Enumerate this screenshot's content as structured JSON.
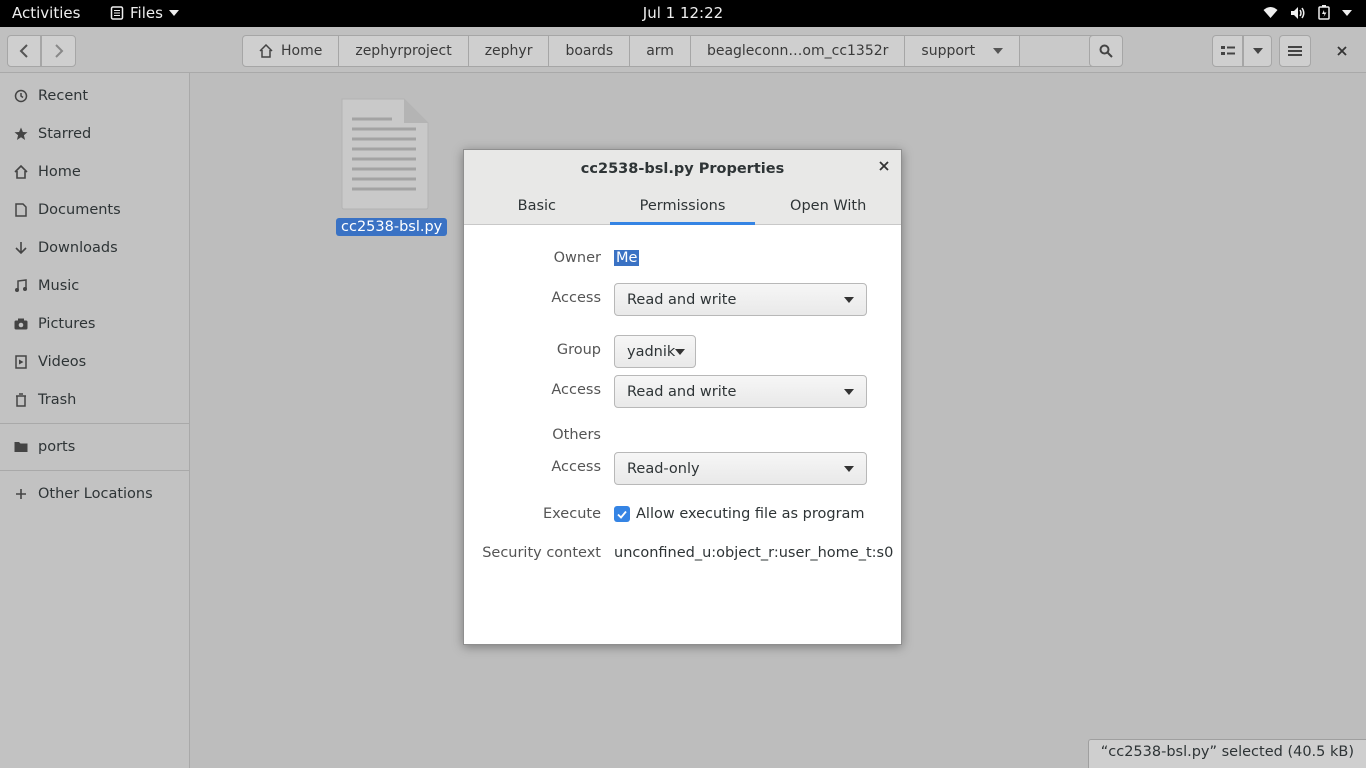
{
  "topbar": {
    "activities": "Activities",
    "app_name": "Files",
    "clock": "Jul 1  12:22",
    "tray": [
      "wifi-icon",
      "volume-icon",
      "battery-icon"
    ]
  },
  "headerbar": {
    "breadcrumbs": [
      "Home",
      "zephyrproject",
      "zephyr",
      "boards",
      "arm",
      "beagleconn…om_cc1352r",
      "support"
    ]
  },
  "sidebar": {
    "items": [
      {
        "label": "Recent",
        "icon": "clock-icon"
      },
      {
        "label": "Starred",
        "icon": "star-icon"
      },
      {
        "label": "Home",
        "icon": "home-icon"
      },
      {
        "label": "Documents",
        "icon": "document-icon"
      },
      {
        "label": "Downloads",
        "icon": "download-icon"
      },
      {
        "label": "Music",
        "icon": "music-icon"
      },
      {
        "label": "Pictures",
        "icon": "camera-icon"
      },
      {
        "label": "Videos",
        "icon": "video-icon"
      },
      {
        "label": "Trash",
        "icon": "trash-icon"
      }
    ],
    "bookmarks": [
      {
        "label": "ports",
        "icon": "folder-icon"
      }
    ],
    "other": {
      "label": "Other Locations",
      "icon": "plus-icon"
    }
  },
  "content": {
    "file_name": "cc2538-bsl.py"
  },
  "status": "“cc2538-bsl.py” selected  (40.5 kB)",
  "dialog": {
    "title": "cc2538-bsl.py Properties",
    "tabs": [
      "Basic",
      "Permissions",
      "Open With"
    ],
    "active_tab": "Permissions",
    "owner_label": "Owner",
    "owner_value": "Me",
    "access_label": "Access",
    "owner_access": "Read and write",
    "group_label": "Group",
    "group_value": "yadnik",
    "group_access": "Read and write",
    "others_label": "Others",
    "others_access": "Read-only",
    "execute_label": "Execute",
    "execute_text": "Allow executing file as program",
    "execute_checked": true,
    "security_label": "Security context",
    "security_value": "unconfined_u:object_r:user_home_t:s0"
  },
  "colors": {
    "accent": "#3584e4",
    "selection": "#3a72c4"
  }
}
